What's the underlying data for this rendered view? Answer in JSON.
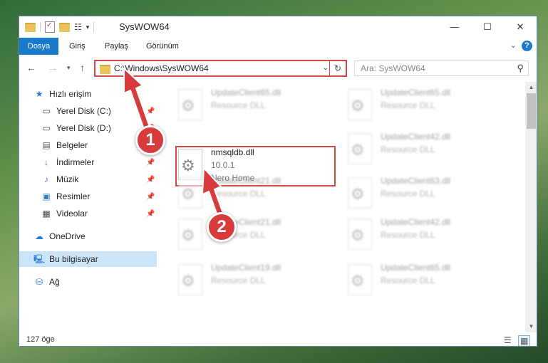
{
  "window": {
    "title": "SysWOW64"
  },
  "ribbon": {
    "tabs": [
      "Dosya",
      "Giriş",
      "Paylaş",
      "Görünüm"
    ]
  },
  "navigation": {
    "address": "C:\\Windows\\SysWOW64",
    "search_placeholder": "Ara: SysWOW64"
  },
  "sidebar": {
    "items": [
      {
        "label": "Hızlı erişim",
        "icon": "star-icon"
      },
      {
        "label": "Yerel Disk (C:)",
        "icon": "drive-icon",
        "pinned": true
      },
      {
        "label": "Yerel Disk (D:)",
        "icon": "drive-icon",
        "pinned": true
      },
      {
        "label": "Belgeler",
        "icon": "document-icon",
        "pinned": true
      },
      {
        "label": "İndirmeler",
        "icon": "download-icon",
        "pinned": true
      },
      {
        "label": "Müzik",
        "icon": "music-icon",
        "pinned": true
      },
      {
        "label": "Resimler",
        "icon": "pictures-icon",
        "pinned": true
      },
      {
        "label": "Videolar",
        "icon": "video-icon",
        "pinned": true
      },
      {
        "label": "OneDrive",
        "icon": "cloud-icon"
      },
      {
        "label": "Bu bilgisayar",
        "icon": "computer-icon",
        "selected": true
      },
      {
        "label": "Ağ",
        "icon": "network-icon"
      }
    ]
  },
  "files": [
    {
      "name": "UpdateClient65.dll",
      "line1": "Resource DLL",
      "line2": ""
    },
    {
      "name": "UpdateClient65.dll",
      "line1": "Resource DLL",
      "line2": ""
    },
    {
      "name": "nmsqldb.dll",
      "line1": "10.0.1",
      "line2": "Nero Home"
    },
    {
      "name": "UpdateClient42.dll",
      "line1": "Resource DLL",
      "line2": ""
    },
    {
      "name": "UpdateClient21.dll",
      "line1": "Resource DLL",
      "line2": ""
    },
    {
      "name": "UpdateClient63.dll",
      "line1": "Resource DLL",
      "line2": ""
    },
    {
      "name": "UpdateClient21.dll",
      "line1": "Resource DLL",
      "line2": ""
    },
    {
      "name": "UpdateClient42.dll",
      "line1": "Resource DLL",
      "line2": ""
    },
    {
      "name": "UpdateClient19.dll",
      "line1": "Resource DLL",
      "line2": ""
    },
    {
      "name": "UpdateClient65.dll",
      "line1": "Resource DLL",
      "line2": ""
    }
  ],
  "status": {
    "count": "127 öge"
  },
  "callouts": [
    "1",
    "2"
  ],
  "colors": {
    "accent": "#1979ca",
    "highlight": "#d54848",
    "badge": "#d83b3b"
  }
}
